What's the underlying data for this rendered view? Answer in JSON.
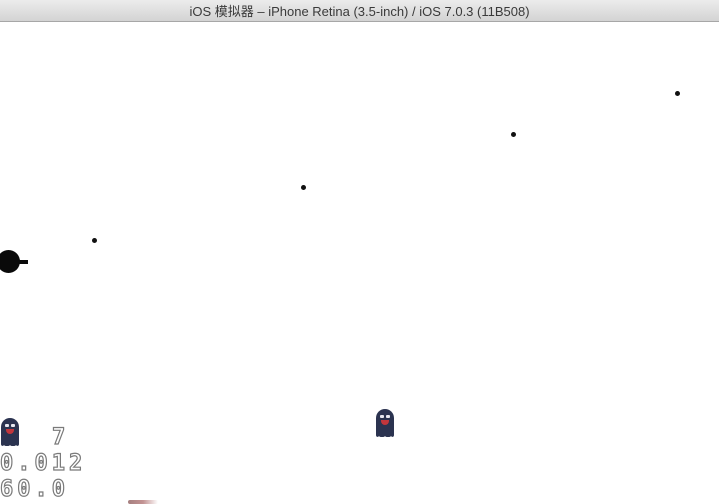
{
  "window": {
    "title": "iOS 模拟器 – iPhone Retina (3.5-inch) / iOS 7.0.3 (11B508)"
  },
  "game": {
    "background_color": "#ffffff",
    "projectile_count_visible": 4,
    "cannon_icon": "cannon-icon",
    "enemy_icon": "ghost-icon",
    "colors": {
      "projectile": "#111111",
      "cannon": "#0a0a0a",
      "ghost_body": "#2b3350",
      "ghost_mouth": "#c2363c",
      "stats_text": "#ffffff",
      "stats_outline": "#7a7a7a"
    }
  },
  "stats": {
    "objects": "7",
    "frame_time": "0.012",
    "fps": "60.0"
  }
}
